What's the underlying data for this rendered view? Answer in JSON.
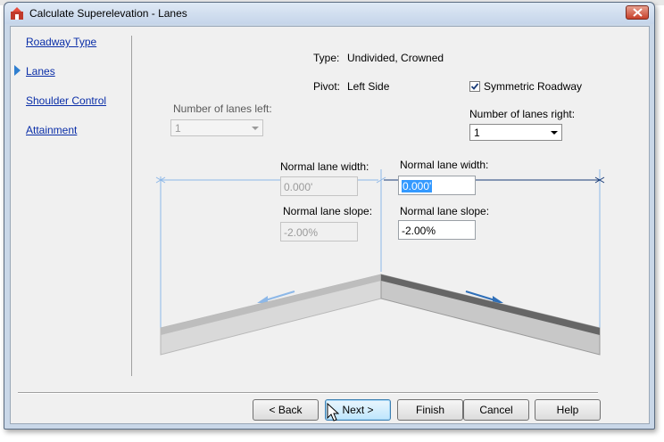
{
  "window": {
    "title": "Calculate Superelevation - Lanes"
  },
  "nav": {
    "items": [
      {
        "label": "Roadway Type"
      },
      {
        "label": "Lanes",
        "active": true
      },
      {
        "label": "Shoulder Control"
      },
      {
        "label": "Attainment"
      }
    ]
  },
  "info": {
    "type_label": "Type:",
    "type_value": "Undivided, Crowned",
    "pivot_label": "Pivot:",
    "pivot_value": "Left Side"
  },
  "symmetric": {
    "label": "Symmetric Roadway",
    "checked": true
  },
  "left": {
    "lanes_label": "Number of lanes left:",
    "lanes_value": "1",
    "width_label": "Normal lane width:",
    "width_value": "0.000'",
    "slope_label": "Normal lane slope:",
    "slope_value": "-2.00%"
  },
  "right": {
    "lanes_label": "Number of lanes right:",
    "lanes_value": "1",
    "width_label": "Normal lane width:",
    "width_value": "0.000'",
    "slope_label": "Normal lane slope:",
    "slope_value": "-2.00%"
  },
  "buttons": {
    "back": "< Back",
    "next": "Next >",
    "finish": "Finish",
    "cancel": "Cancel",
    "help": "Help"
  },
  "colors": {
    "accent": "#2f7fd0",
    "link": "#0a2ea8",
    "dimension": "#8db8e8"
  }
}
